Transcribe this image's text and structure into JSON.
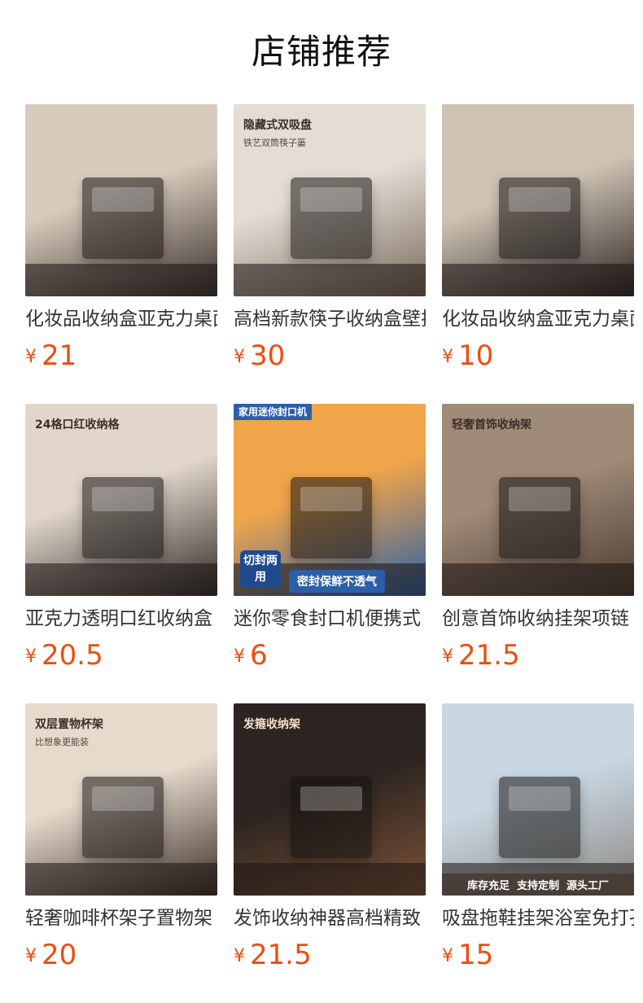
{
  "page": {
    "title": "店铺推荐"
  },
  "products": [
    {
      "name": "化妆品收纳盒亚克力桌面",
      "price_symbol": "¥",
      "price": "21",
      "image": {
        "overlay": "",
        "sub": "",
        "badge": "",
        "colors": [
          "#d8cbbd",
          "#3a302b"
        ]
      }
    },
    {
      "name": "高档新款筷子收纳盒壁挂",
      "price_symbol": "¥",
      "price": "30",
      "image": {
        "overlay": "隐藏式双吸盘",
        "sub": "铁艺双筒筷子篓",
        "badge": "",
        "colors": [
          "#e4ddd5",
          "#7a6a5c"
        ]
      }
    },
    {
      "name": "化妆品收纳盒亚克力桌面",
      "price_symbol": "¥",
      "price": "10",
      "image": {
        "overlay": "",
        "sub": "",
        "badge": "",
        "colors": [
          "#cfc2b4",
          "#2d2724"
        ]
      }
    },
    {
      "name": "亚克力透明口红收纳盒",
      "price_symbol": "¥",
      "price": "20.5",
      "image": {
        "overlay": "24格口红收纳格",
        "sub": "",
        "badge": "",
        "colors": [
          "#e2d6ca",
          "#2f2a27"
        ]
      }
    },
    {
      "name": "迷你零食封口机便携式",
      "price_symbol": "¥",
      "price": "6",
      "image": {
        "overlay": "家用迷你封口机",
        "sub": "",
        "badge": "密封保鲜不透气",
        "badge2": "切封两用",
        "colors": [
          "#f0a54a",
          "#2b5fa8"
        ]
      }
    },
    {
      "name": "创意首饰收纳挂架项链",
      "price_symbol": "¥",
      "price": "21.5",
      "image": {
        "overlay": "轻奢首饰收纳架",
        "sub": "",
        "badge": "",
        "colors": [
          "#a08a78",
          "#4a3a30"
        ]
      }
    },
    {
      "name": "轻奢咖啡杯架子置物架",
      "price_symbol": "¥",
      "price": "20",
      "image": {
        "overlay": "双层置物杯架",
        "sub": "比想象更能装",
        "badge": "",
        "colors": [
          "#e6dacd",
          "#3b2e27"
        ]
      }
    },
    {
      "name": "发饰收纳神器高档精致",
      "price_symbol": "¥",
      "price": "21.5",
      "image": {
        "overlay": "发箍收纳架",
        "sub": "",
        "badge": "",
        "colors": [
          "#2c2420",
          "#7a5238"
        ]
      }
    },
    {
      "name": "吸盘拖鞋挂架浴室免打孔",
      "price_symbol": "¥",
      "price": "15",
      "image": {
        "overlay": "",
        "sub": "",
        "badge": "库存充足  支持定制  源头工厂",
        "colors": [
          "#c9d7e2",
          "#8e8a86"
        ]
      }
    }
  ]
}
